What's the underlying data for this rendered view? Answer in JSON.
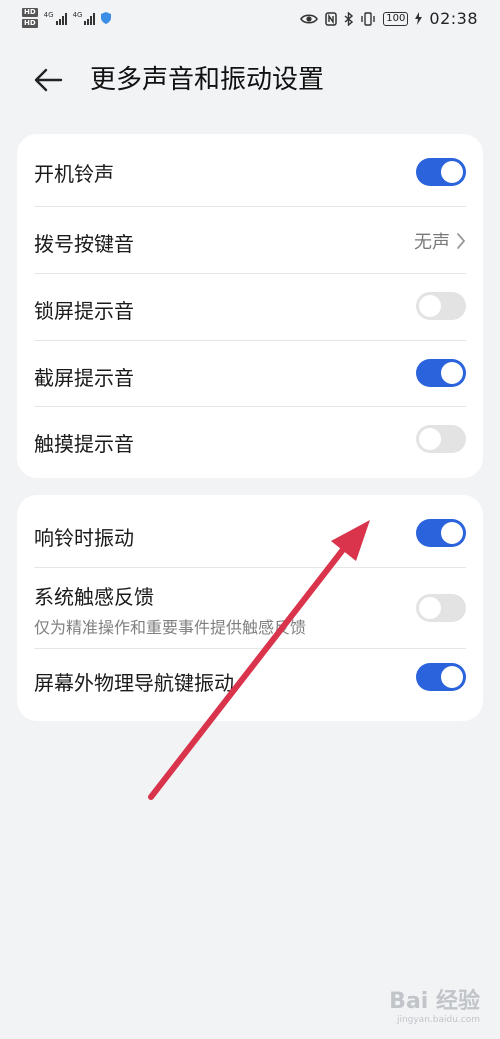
{
  "status_bar": {
    "hd1": "HD",
    "hd2": "HD",
    "net1": "4G",
    "net2": "4G",
    "battery": "100",
    "time": "02:38"
  },
  "header": {
    "title": "更多声音和振动设置"
  },
  "card1": {
    "rows": [
      {
        "label": "开机铃声",
        "control": "toggle",
        "state": "on"
      },
      {
        "label": "拨号按键音",
        "control": "value",
        "value": "无声"
      },
      {
        "label": "锁屏提示音",
        "control": "toggle",
        "state": "off"
      },
      {
        "label": "截屏提示音",
        "control": "toggle",
        "state": "on"
      },
      {
        "label": "触摸提示音",
        "control": "toggle",
        "state": "off"
      }
    ]
  },
  "card2": {
    "rows": [
      {
        "label": "响铃时振动",
        "control": "toggle",
        "state": "on"
      },
      {
        "label": "系统触感反馈",
        "sub": "仅为精准操作和重要事件提供触感反馈",
        "control": "toggle",
        "state": "off"
      },
      {
        "label": "屏幕外物理导航键振动",
        "control": "toggle",
        "state": "on"
      }
    ]
  },
  "watermark": {
    "logo": "Bai 经验",
    "site": "jingyan.baidu.com"
  },
  "colors": {
    "accent": "#2a63dc",
    "toggle_off": "#e3e3e3",
    "arrow": "#d9344c",
    "background": "#f1f3f5"
  }
}
